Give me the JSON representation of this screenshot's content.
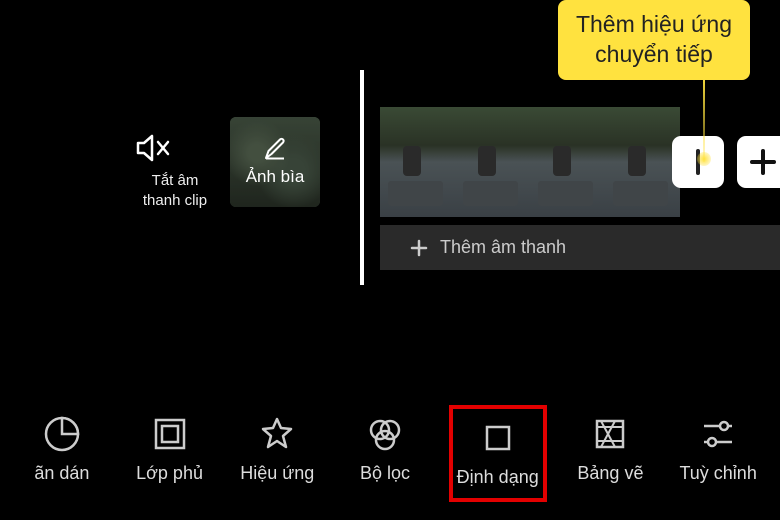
{
  "tooltip": {
    "line1": "Thêm hiệu ứng",
    "line2": "chuyển tiếp"
  },
  "editor": {
    "mute_label": "Tắt âm thanh clip",
    "cover_label": "Ảnh bìa",
    "audio_add": "Thêm âm thanh"
  },
  "toolbar": {
    "items": [
      {
        "label": "ãn dán",
        "icon": "sticker"
      },
      {
        "label": "Lớp phủ",
        "icon": "overlay"
      },
      {
        "label": "Hiệu ứng",
        "icon": "effects"
      },
      {
        "label": "Bộ lọc",
        "icon": "filter"
      },
      {
        "label": "Định dạng",
        "icon": "format",
        "highlighted": true
      },
      {
        "label": "Bảng vẽ",
        "icon": "canvas"
      },
      {
        "label": "Tuỳ chỉnh",
        "icon": "adjust"
      }
    ]
  },
  "icons": {
    "mute": "speaker-mute",
    "pencil": "pencil",
    "plus": "plus",
    "transition": "transition-handle"
  }
}
